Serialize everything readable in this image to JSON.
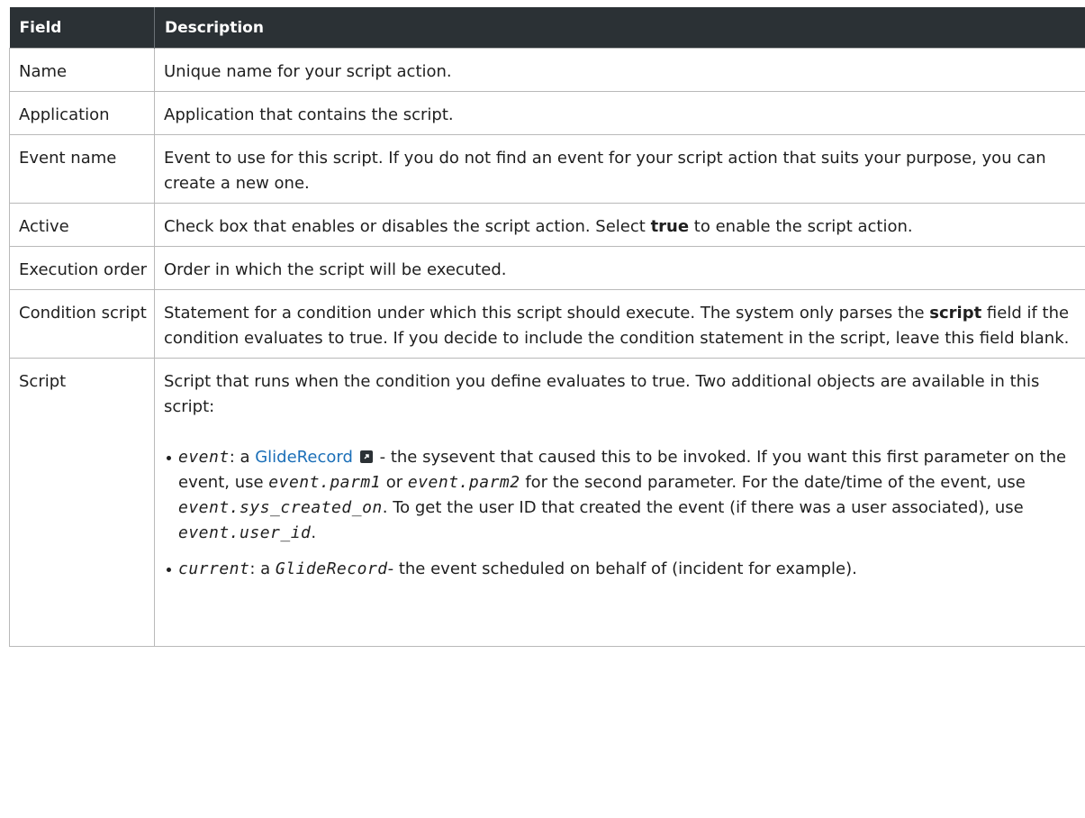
{
  "table": {
    "headers": {
      "field": "Field",
      "description": "Description"
    },
    "rows": [
      {
        "field": "Name",
        "description": "Unique name for your script action."
      },
      {
        "field": "Application",
        "description": "Application that contains the script."
      },
      {
        "field": "Event name",
        "description": "Event to use for this script. If you do not find an event for your script action that suits your purpose, you can create a new one."
      },
      {
        "field": "Active",
        "desc_pre": "Check box that enables or disables the script action. Select ",
        "desc_bold": "true",
        "desc_post": " to enable the script action."
      },
      {
        "field": "Execution order",
        "description": "Order in which the script will be executed."
      },
      {
        "field": "Condition script",
        "desc_pre": "Statement for a condition under which this script should execute. The system only parses the ",
        "desc_bold": "script",
        "desc_post": " field if the condition evaluates to true. If you decide to include the condition statement in the script, leave this field blank."
      },
      {
        "field": "Script",
        "description": "Script that runs when the condition you define evaluates to true. Two additional objects are available in this script:",
        "event_item": {
          "code": "event",
          "colon": ": a ",
          "link": "GlideRecord",
          "t1": " - the sysevent that caused this to be invoked. If you want this first parameter on the event, use ",
          "c1": "event.parm1",
          "t2": " or ",
          "c2": "event.parm2",
          "t3": " for the second parameter. For the date/time of the event, use ",
          "c3": "event.sys_created_on",
          "t4": ". To get the user ID that created the event (if there was a user associated), use ",
          "c4": "event.user_id",
          "t5": "."
        },
        "current_item": {
          "code": "current",
          "colon": ": a ",
          "c1": "GlideRecord",
          "t1": "- the event scheduled on behalf of (incident for example)."
        }
      }
    ]
  },
  "icons": {
    "external_link": "external-link-icon"
  }
}
